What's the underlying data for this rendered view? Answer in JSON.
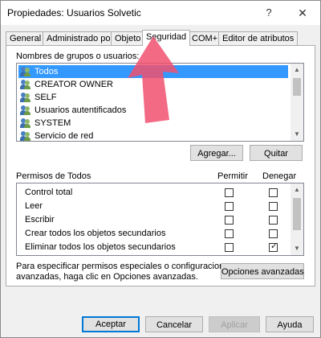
{
  "window": {
    "title": "Propiedades: Usuarios Solvetic",
    "help_glyph": "?",
    "close_glyph": "✕"
  },
  "tabs": [
    {
      "label": "General",
      "active": false
    },
    {
      "label": "Administrado por",
      "active": false
    },
    {
      "label": "Objeto",
      "active": false
    },
    {
      "label": "Seguridad",
      "active": true
    },
    {
      "label": "COM+",
      "active": false
    },
    {
      "label": "Editor de atributos",
      "active": false
    }
  ],
  "groups": {
    "label": "Nombres de grupos o usuarios:",
    "items": [
      {
        "label": "Todos",
        "selected": true,
        "icon": "users-icon"
      },
      {
        "label": "CREATOR OWNER",
        "selected": false,
        "icon": "users-icon"
      },
      {
        "label": "SELF",
        "selected": false,
        "icon": "users-icon"
      },
      {
        "label": "Usuarios autentificados",
        "selected": false,
        "icon": "users-icon"
      },
      {
        "label": "SYSTEM",
        "selected": false,
        "icon": "users-icon"
      },
      {
        "label": "Servicio de red",
        "selected": false,
        "icon": "users-icon"
      }
    ],
    "add_button": "Agregar...",
    "remove_button": "Quitar"
  },
  "permissions": {
    "header": "Permisos de Todos",
    "allow_header": "Permitir",
    "deny_header": "Denegar",
    "rows": [
      {
        "name": "Control total",
        "allow": false,
        "deny": false
      },
      {
        "name": "Leer",
        "allow": false,
        "deny": false
      },
      {
        "name": "Escribir",
        "allow": false,
        "deny": false
      },
      {
        "name": "Crear todos los objetos secundarios",
        "allow": false,
        "deny": false
      },
      {
        "name": "Eliminar todos los objetos secundarios",
        "allow": false,
        "deny": true
      }
    ]
  },
  "advanced": {
    "text_line1": "Para especificar permisos especiales o configuraciones",
    "text_line2": "avanzadas, haga clic en Opciones avanzadas.",
    "button": "Opciones avanzadas"
  },
  "footer": {
    "ok": "Aceptar",
    "cancel": "Cancelar",
    "apply": "Aplicar",
    "help": "Ayuda"
  },
  "colors": {
    "selection": "#3399ff",
    "arrow": "#f0506e",
    "default_button_border": "#0078d7"
  }
}
